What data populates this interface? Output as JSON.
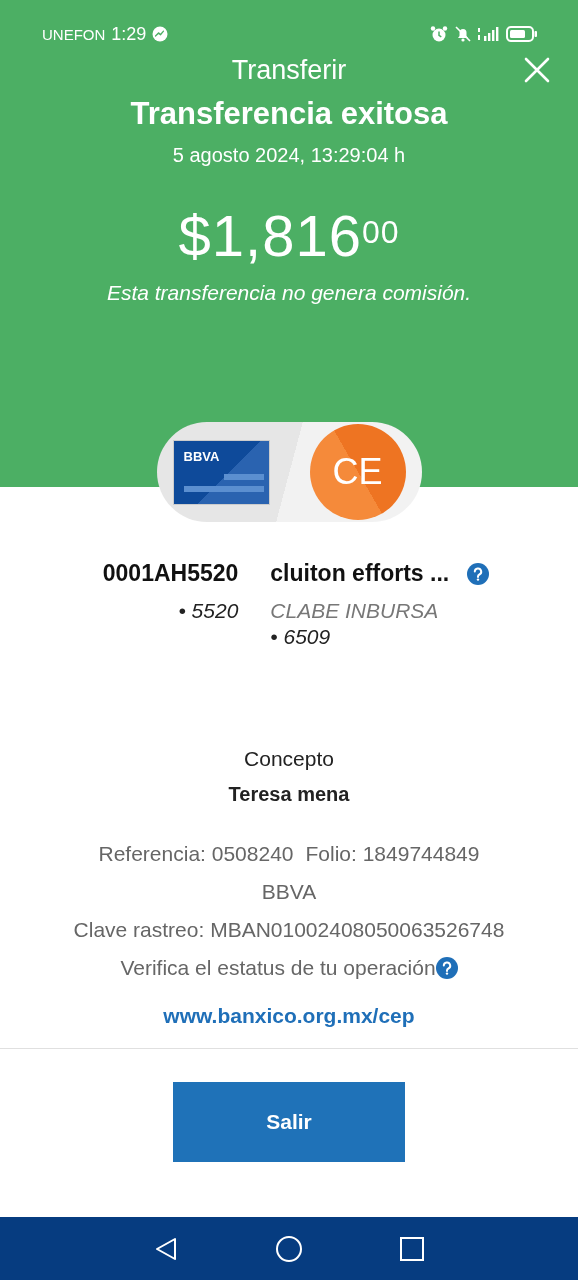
{
  "status_bar": {
    "carrier": "UNEFON",
    "time": "1:29"
  },
  "header": {
    "title": "Transferir"
  },
  "result": {
    "title": "Transferencia exitosa",
    "datetime": "5 agosto 2024, 13:29:04 h",
    "amount": "$1,816",
    "amount_cents": "00",
    "note": "Esta transferencia no genera comisión."
  },
  "origin": {
    "bank_logo": "BBVA",
    "name": "0001AH5520",
    "account": "• 5520"
  },
  "destination": {
    "initials": "CE",
    "name": "cluiton efforts ...",
    "bank": "CLABE INBURSA",
    "account": "• 6509"
  },
  "concept": {
    "label": "Concepto",
    "value": "Teresa mena"
  },
  "details": {
    "reference": "Referencia: 0508240",
    "folio": "Folio: 1849744849",
    "bank": "BBVA",
    "tracking": "Clave rastreo: MBAN01002408050063526748",
    "verify": "Verifica el estatus de tu operación",
    "link": "www.banxico.org.mx/cep"
  },
  "buttons": [
    {
      "label": "Salir"
    }
  ]
}
